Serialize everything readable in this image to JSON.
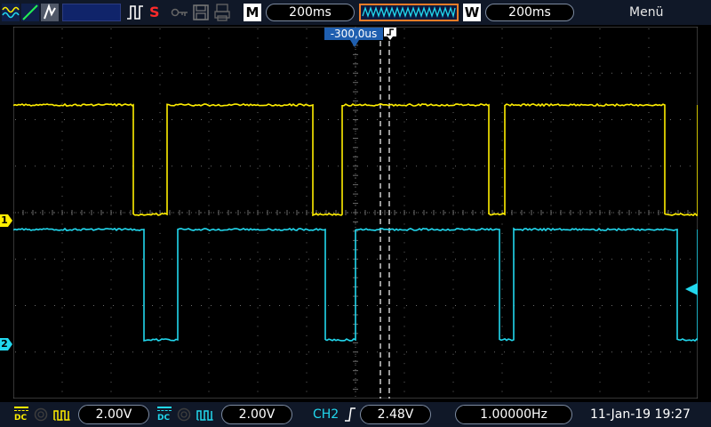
{
  "colors": {
    "ch1": "#ffee00",
    "ch2": "#22d8ee",
    "accent_orange": "#f07c28",
    "grid": "#6a6a6a"
  },
  "top_bar": {
    "icons": [
      "run-stop-icon",
      "trigger-type-icon",
      "persistence-icon",
      "blank-slot-icon",
      "pulse-icon",
      "single-shot-icon",
      "key-icon",
      "save-icon",
      "print-icon"
    ],
    "single_label": "S",
    "main_label": "M",
    "main_timebase": "200ms",
    "window_label": "W",
    "window_timebase": "200ms",
    "menu_label": "Menü"
  },
  "trigger_position": "-300,0us",
  "channel_markers": {
    "ch1": "1",
    "ch2": "2"
  },
  "bottom_bar": {
    "ch1": {
      "coupling": "DC",
      "scale": "2.00V"
    },
    "ch2": {
      "coupling": "DC",
      "scale": "2.00V"
    },
    "trigger_source": "CH2",
    "trigger_level": "2.48V",
    "frequency": "1.00000Hz",
    "datetime": "11-Jan-19 19:27"
  }
}
